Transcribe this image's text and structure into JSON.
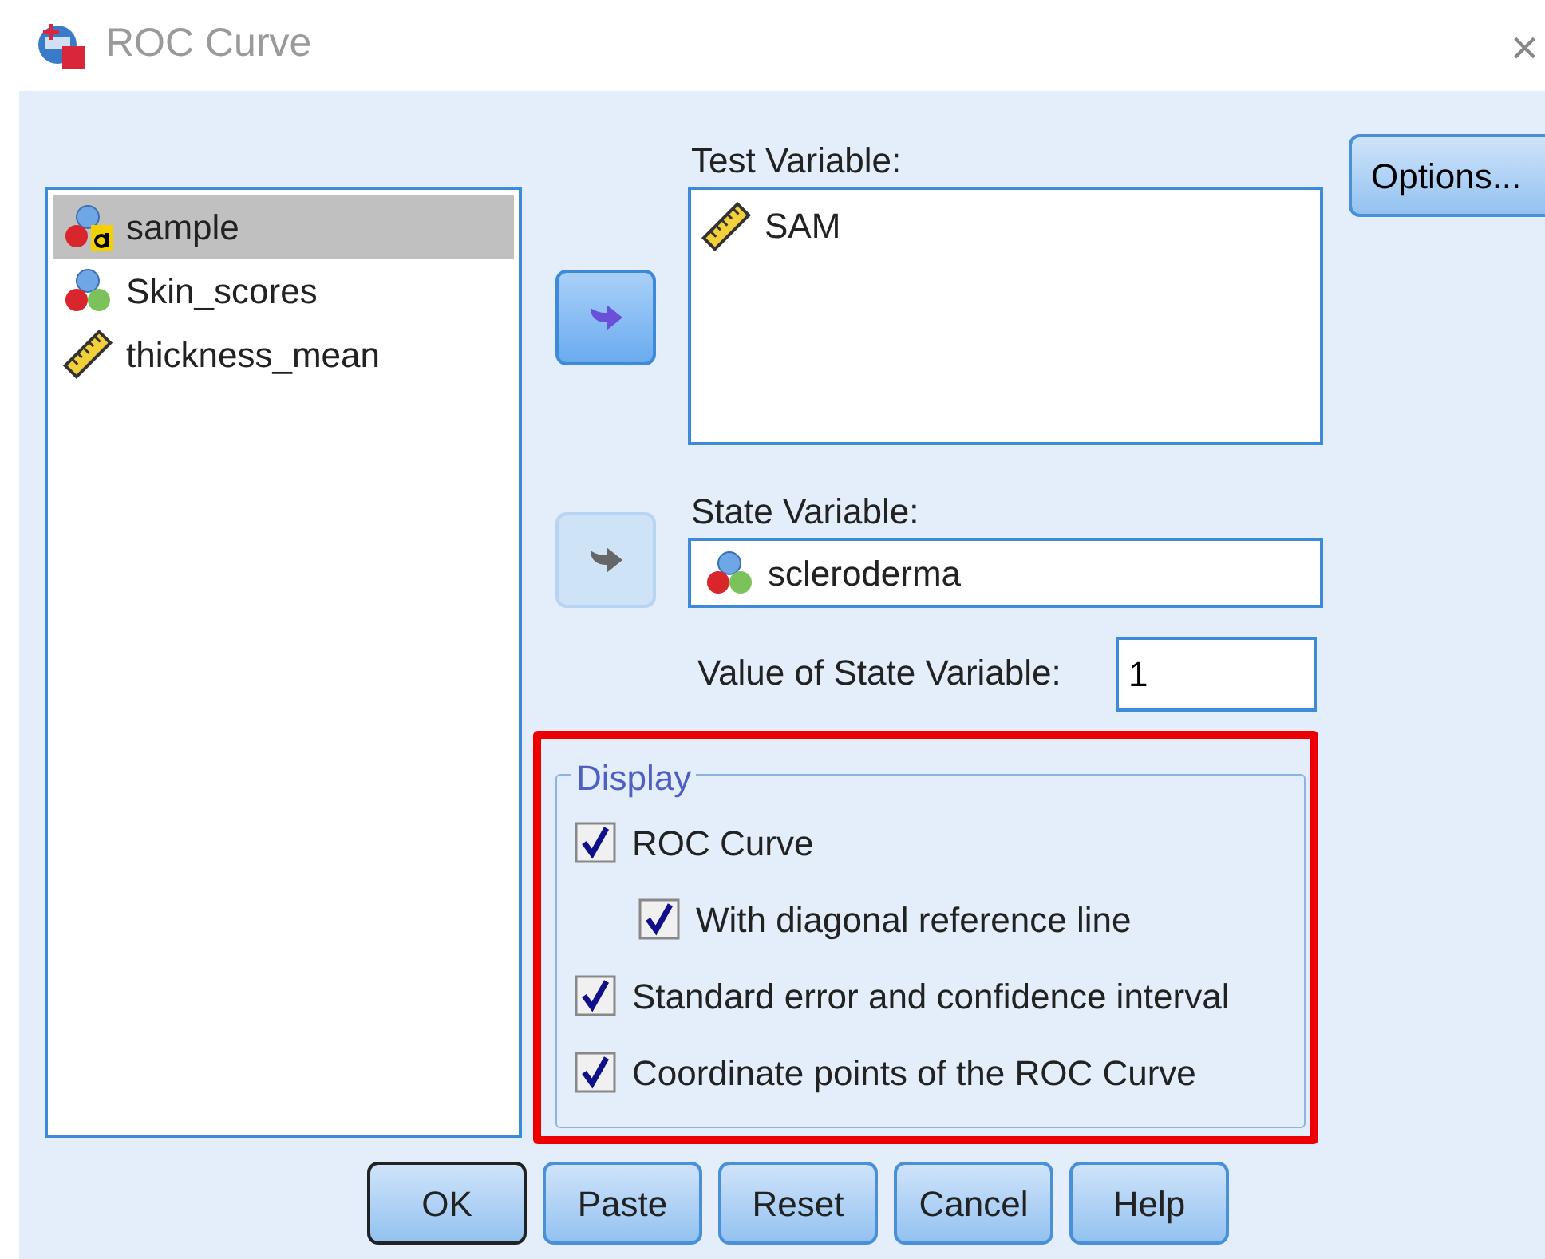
{
  "window": {
    "title": "ROC Curve",
    "close": "×"
  },
  "variables": [
    {
      "name": "sample",
      "kind": "nominal_string",
      "selected": true
    },
    {
      "name": "Skin_scores",
      "kind": "nominal",
      "selected": false
    },
    {
      "name": "thickness_mean",
      "kind": "scale",
      "selected": false
    }
  ],
  "test_variable": {
    "label": "Test Variable:",
    "items": [
      {
        "name": "SAM",
        "kind": "scale"
      }
    ],
    "move_disabled": false
  },
  "state_variable": {
    "label": "State Variable:",
    "value": {
      "name": "scleroderma",
      "kind": "nominal"
    },
    "move_disabled": true
  },
  "state_value": {
    "label": "Value of State Variable:",
    "value": "1"
  },
  "display": {
    "title": "Display",
    "options": [
      {
        "label": "ROC Curve",
        "checked": true,
        "indented": false
      },
      {
        "label": "With diagonal reference line",
        "checked": true,
        "indented": true
      },
      {
        "label": "Standard error and confidence interval",
        "checked": true,
        "indented": false
      },
      {
        "label": "Coordinate points of the ROC Curve",
        "checked": true,
        "indented": false
      }
    ]
  },
  "options_button": "Options...",
  "buttons": [
    {
      "label": "OK",
      "default": true
    },
    {
      "label": "Paste",
      "default": false
    },
    {
      "label": "Reset",
      "default": false
    },
    {
      "label": "Cancel",
      "default": false
    },
    {
      "label": "Help",
      "default": false
    }
  ]
}
